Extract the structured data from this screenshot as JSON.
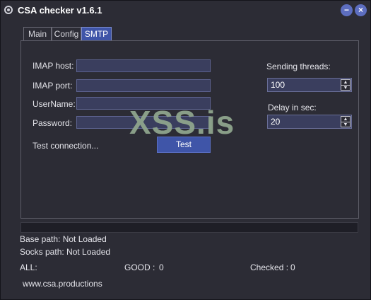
{
  "window": {
    "title": "CSA checker v1.6.1",
    "minimize": "−",
    "close": "×"
  },
  "tabs": [
    {
      "label": "Main"
    },
    {
      "label": "Config"
    },
    {
      "label": "SMTP"
    }
  ],
  "smtp": {
    "imap_host_label": "IMAP host:",
    "imap_host_value": "",
    "imap_port_label": "IMAP port:",
    "imap_port_value": "",
    "username_label": "UserName:",
    "username_value": "",
    "password_label": "Password:",
    "password_value": "",
    "test_connection_label": "Test connection...",
    "test_button": "Test",
    "sending_threads_label": "Sending threads:",
    "sending_threads_value": "100",
    "delay_label": "Delay in sec:",
    "delay_value": "20"
  },
  "watermark": "XSS.is",
  "progress": 0,
  "status": {
    "base_path": "Base path: Not Loaded",
    "socks_path": "Socks path: Not Loaded",
    "all_label": "ALL:",
    "good_label": "GOOD :",
    "good_value": "0",
    "checked_label": "Checked :",
    "checked_value": "0",
    "website": "www.csa.productions"
  },
  "icons": {
    "app": "app-logo-icon",
    "minimize": "minimize-icon",
    "close": "close-icon",
    "spin_up": "arrow-up-icon",
    "spin_down": "arrow-down-icon"
  },
  "colors": {
    "background": "#2c2c35",
    "accent": "#3f55a8",
    "field": "#3a3e5e",
    "watermark": "#8fa58d"
  }
}
